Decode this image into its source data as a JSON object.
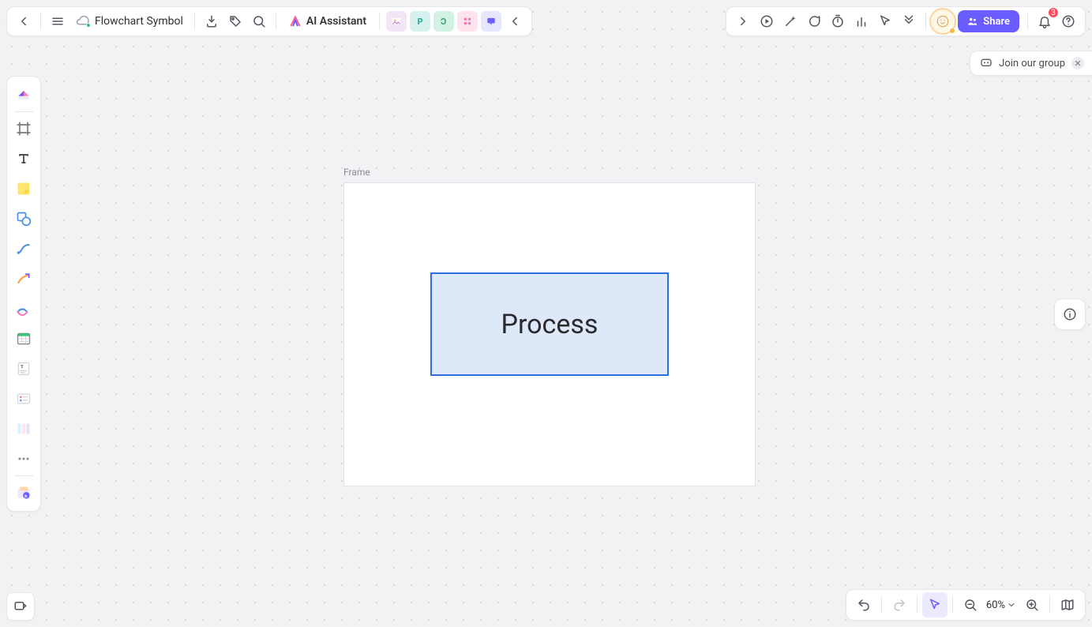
{
  "header": {
    "document_title": "Flowchart Symbol",
    "ai_assistant_label": "AI Assistant",
    "collab_squares": [
      {
        "id": "sq-image",
        "bg": "#f0e6f5"
      },
      {
        "id": "sq-p",
        "bg": "#d6f1ee",
        "letter": "P",
        "letter_color": "#2aa69a"
      },
      {
        "id": "sq-c",
        "bg": "#d4f2e3",
        "letter": "C",
        "letter_color": "#2aa66a",
        "mirror": true
      },
      {
        "id": "sq-grid",
        "bg": "#ffe4ef"
      },
      {
        "id": "sq-chat",
        "bg": "#e6e6ff"
      }
    ],
    "share_label": "Share",
    "notification_count": "3"
  },
  "join_group": {
    "label": "Join our group"
  },
  "canvas": {
    "frame_label": "Frame",
    "shape_text": "Process"
  },
  "bottom": {
    "zoom_label": "60%"
  },
  "left_tools": [
    "logo-tool",
    "frame-tool",
    "text-tool",
    "sticky-note-tool",
    "shape-tool",
    "connector-tool",
    "pen-tool",
    "highlighter-tool",
    "table-tool",
    "doc-tool",
    "card-tool",
    "kanban-tool",
    "more-tool",
    "apps-tool"
  ]
}
